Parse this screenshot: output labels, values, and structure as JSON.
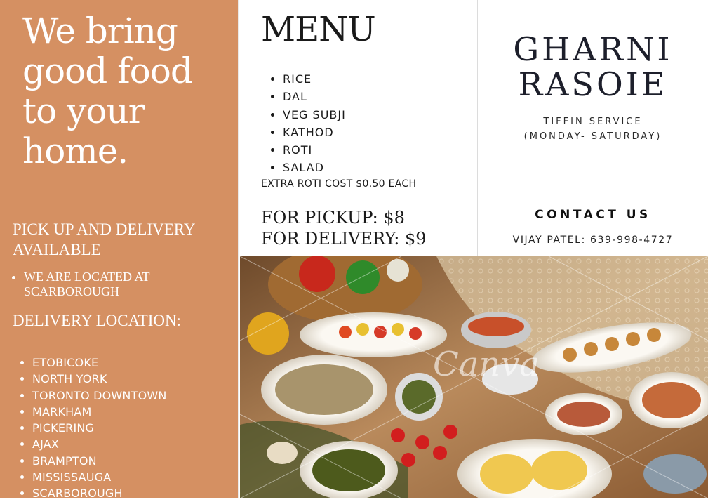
{
  "left_panel": {
    "headline": "We bring good food to your home.",
    "pickup_heading": "PICK UP AND DELIVERY AVAILABLE",
    "location_note": "WE ARE LOCATED AT SCARBOROUGH",
    "delivery_heading": "DELIVERY LOCATION:",
    "delivery_locations": [
      "ETOBICOKE",
      "NORTH YORK",
      "TORONTO DOWNTOWN",
      "MARKHAM",
      "PICKERING",
      "AJAX",
      "BRAMPTON",
      "MISSISSAUGA",
      "SCARBOROUGH"
    ],
    "background_color": "#d59062"
  },
  "menu_panel": {
    "title": "MENU",
    "items": [
      "RICE",
      "DAL",
      "VEG SUBJI",
      "KATHOD",
      "ROTI",
      "SALAD"
    ],
    "extra_note": "EXTRA ROTI COST $0.50 EACH",
    "pickup_price": "FOR PICKUP: $8",
    "delivery_price": "FOR DELIVERY: $9"
  },
  "brand_panel": {
    "name_line1": "GHARNI",
    "name_line2": "RASOIE",
    "tagline_line1": "TIFFIN SERVICE",
    "tagline_line2": "(MONDAY- SATURDAY)",
    "contact_heading": "CONTACT US",
    "contact_line": "VIJAY PATEL: 639-998-4727"
  },
  "photo": {
    "watermark": "Canva"
  }
}
